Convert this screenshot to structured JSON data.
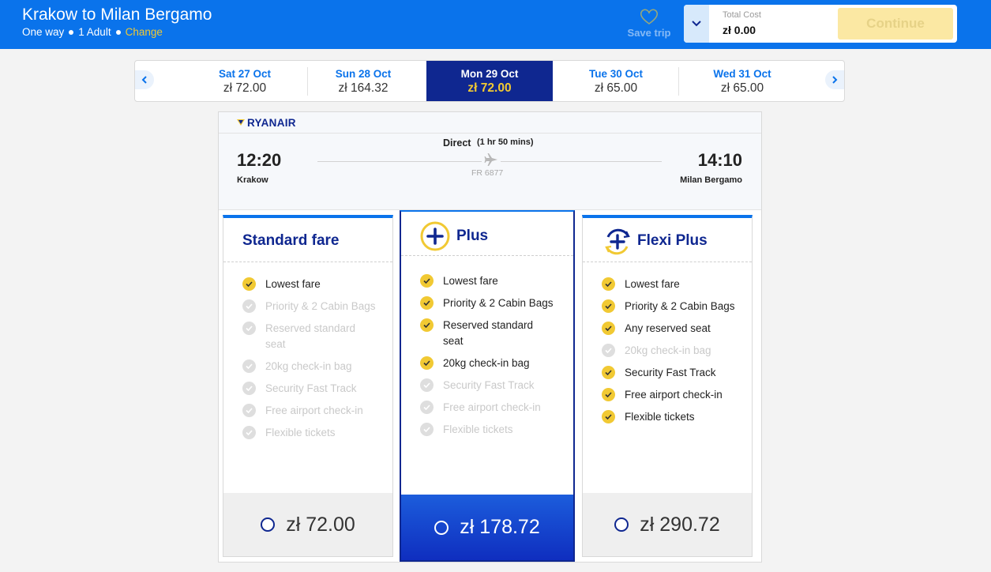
{
  "header": {
    "title": "Krakow to Milan Bergamo",
    "trip_type": "One way",
    "passengers": "1 Adult",
    "change_label": "Change",
    "save_trip_label": "Save trip",
    "total_cost_label": "Total Cost",
    "total_cost_value": "zł 0.00",
    "continue_label": "Continue"
  },
  "dates": [
    {
      "day": "Sat 27 Oct",
      "price": "zł 72.00"
    },
    {
      "day": "Sun 28 Oct",
      "price": "zł 164.32"
    },
    {
      "day": "Mon 29 Oct",
      "price": "zł 72.00",
      "selected": true
    },
    {
      "day": "Tue 30 Oct",
      "price": "zł 65.00"
    },
    {
      "day": "Wed 31 Oct",
      "price": "zł 65.00"
    }
  ],
  "flight": {
    "airline": "RYANAIR",
    "departure_time": "12:20",
    "departure_city": "Krakow",
    "arrival_time": "14:10",
    "arrival_city": "Milan Bergamo",
    "type": "Direct",
    "duration": "(1 hr 50 mins)",
    "flight_number": "FR 6877"
  },
  "fares": [
    {
      "name": "Standard fare",
      "price": "zł 72.00",
      "features": [
        {
          "label": "Lowest fare",
          "included": true
        },
        {
          "label": "Priority & 2 Cabin Bags",
          "included": false
        },
        {
          "label": "Reserved standard seat",
          "included": false
        },
        {
          "label": "20kg check-in bag",
          "included": false
        },
        {
          "label": "Security Fast Track",
          "included": false
        },
        {
          "label": "Free airport check-in",
          "included": false
        },
        {
          "label": "Flexible tickets",
          "included": false
        }
      ]
    },
    {
      "name": "Plus",
      "price": "zł 178.72",
      "features": [
        {
          "label": "Lowest fare",
          "included": true
        },
        {
          "label": "Priority & 2 Cabin Bags",
          "included": true
        },
        {
          "label": "Reserved standard seat",
          "included": true
        },
        {
          "label": "20kg check-in bag",
          "included": true
        },
        {
          "label": "Security Fast Track",
          "included": false
        },
        {
          "label": "Free airport check-in",
          "included": false
        },
        {
          "label": "Flexible tickets",
          "included": false
        }
      ]
    },
    {
      "name": "Flexi Plus",
      "price": "zł 290.72",
      "features": [
        {
          "label": "Lowest fare",
          "included": true
        },
        {
          "label": "Priority & 2 Cabin Bags",
          "included": true
        },
        {
          "label": "Any reserved seat",
          "included": true
        },
        {
          "label": "20kg check-in bag",
          "included": false
        },
        {
          "label": "Security Fast Track",
          "included": true
        },
        {
          "label": "Free airport check-in",
          "included": true
        },
        {
          "label": "Flexible tickets",
          "included": true
        }
      ]
    }
  ],
  "colors": {
    "header_blue": "#0a73eb",
    "navy": "#0f2790",
    "yellow": "#f1c933"
  }
}
